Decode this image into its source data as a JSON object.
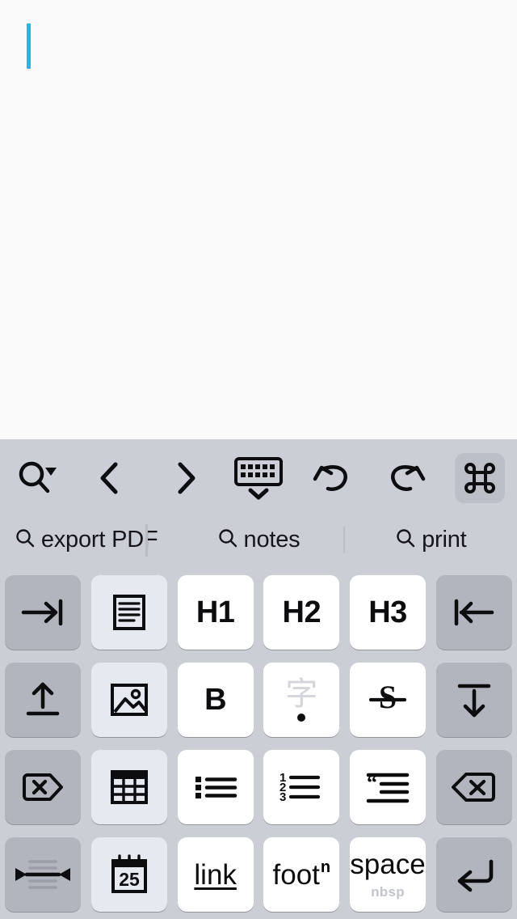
{
  "document": {
    "caret_color": "#22b7ea",
    "background": "#fafafa",
    "content": ""
  },
  "toolbar": {
    "background": "#ccced6",
    "buttons": [
      {
        "name": "search-dropdown",
        "icon": "search-dropdown-icon",
        "label": "Search",
        "active": false
      },
      {
        "name": "previous",
        "icon": "chevron-left-icon",
        "label": "Previous",
        "active": false
      },
      {
        "name": "next",
        "icon": "chevron-right-icon",
        "label": "Next",
        "active": false
      },
      {
        "name": "hide-keyboard",
        "icon": "keyboard-down-icon",
        "label": "Hide Keyboard",
        "active": false
      },
      {
        "name": "undo",
        "icon": "undo-icon",
        "label": "Undo",
        "active": false
      },
      {
        "name": "redo",
        "icon": "redo-icon",
        "label": "Redo",
        "active": false
      },
      {
        "name": "command",
        "icon": "command-icon",
        "label": "Command",
        "active": true
      }
    ]
  },
  "suggestions": {
    "items": [
      {
        "icon": "search-icon",
        "label": "export PDF",
        "has_separator": false,
        "has_cursor": true
      },
      {
        "icon": "search-icon",
        "label": "notes",
        "has_separator": true,
        "has_cursor": false
      },
      {
        "icon": "search-icon",
        "label": "print",
        "has_separator": false,
        "has_cursor": false
      }
    ]
  },
  "keyboard": {
    "colors": {
      "key_white": "#ffffff",
      "key_light": "#e6e9f0",
      "key_gray": "#b2b5be",
      "background": "#ccced6"
    },
    "keys": [
      {
        "icon": "tab-right-icon",
        "label": "Tab",
        "style": "gray",
        "type": "icon"
      },
      {
        "icon": "document-lines-icon",
        "label": "Document",
        "style": "light",
        "type": "icon"
      },
      {
        "icon": "",
        "label": "H1",
        "style": "white",
        "type": "text"
      },
      {
        "icon": "",
        "label": "H2",
        "style": "white",
        "type": "text"
      },
      {
        "icon": "",
        "label": "H3",
        "style": "white",
        "type": "text"
      },
      {
        "icon": "arrow-to-line-left-icon",
        "label": "Line Start",
        "style": "gray",
        "type": "icon"
      },
      {
        "icon": "arrow-up-from-line-icon",
        "label": "Move Up",
        "style": "gray",
        "type": "icon"
      },
      {
        "icon": "image-icon",
        "label": "Image",
        "style": "light",
        "type": "icon"
      },
      {
        "icon": "",
        "label": "B",
        "style": "white",
        "type": "text"
      },
      {
        "icon": "cjk-char-icon",
        "label": "字",
        "style": "white",
        "type": "cjk"
      },
      {
        "icon": "strikethrough-icon",
        "label": "Strikethrough",
        "style": "white",
        "type": "icon"
      },
      {
        "icon": "arrow-down-to-line-icon",
        "label": "Move Down",
        "style": "gray",
        "type": "icon"
      },
      {
        "icon": "delete-tag-icon",
        "label": "Delete Tag",
        "style": "gray",
        "type": "icon"
      },
      {
        "icon": "table-icon",
        "label": "Table",
        "style": "light",
        "type": "icon"
      },
      {
        "icon": "bullet-list-icon",
        "label": "Bullet List",
        "style": "white",
        "type": "icon"
      },
      {
        "icon": "numbered-list-icon",
        "label": "Numbered List",
        "style": "white",
        "type": "icon"
      },
      {
        "icon": "blockquote-icon",
        "label": "Blockquote",
        "style": "white",
        "type": "icon"
      },
      {
        "icon": "backspace-icon",
        "label": "Backspace",
        "style": "gray",
        "type": "icon"
      },
      {
        "icon": "select-line-icon",
        "label": "Select Line",
        "style": "gray",
        "type": "icon"
      },
      {
        "icon": "calendar-icon",
        "label": "Date",
        "style": "light",
        "type": "icon",
        "badge": "25"
      },
      {
        "icon": "",
        "label": "link",
        "style": "white",
        "type": "link"
      },
      {
        "icon": "",
        "label": "foot",
        "style": "white",
        "type": "foot",
        "superscript": "n"
      },
      {
        "icon": "",
        "label": "space",
        "style": "white",
        "type": "space",
        "sublabel": "nbsp"
      },
      {
        "icon": "return-icon",
        "label": "Return",
        "style": "gray",
        "type": "icon"
      }
    ]
  }
}
